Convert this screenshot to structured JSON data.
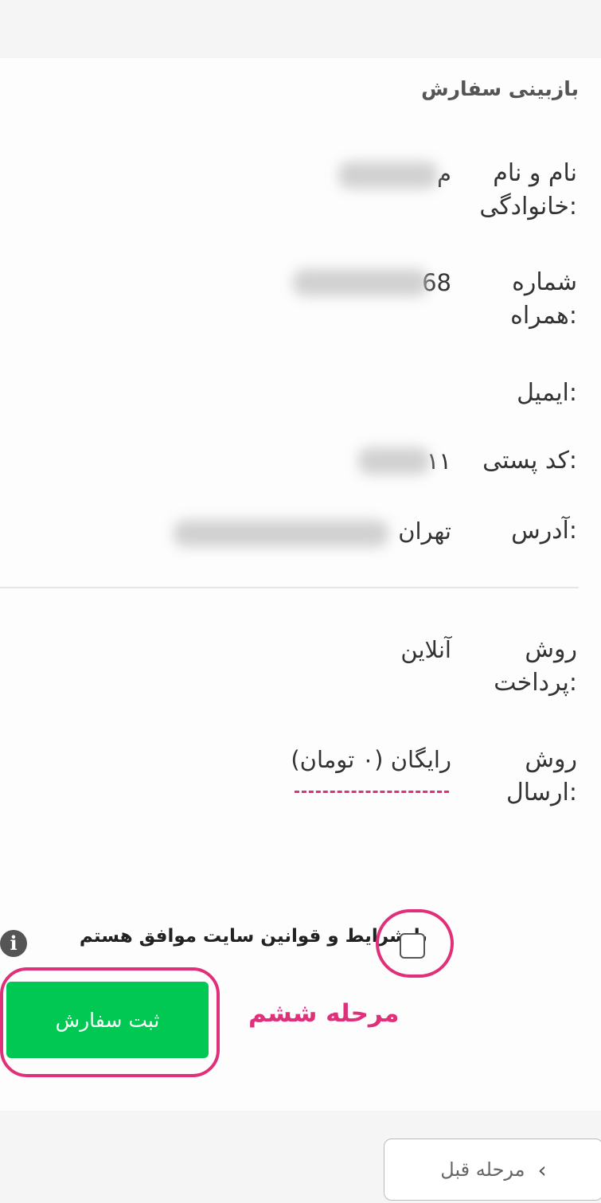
{
  "review": {
    "title": "بازبینی سفارش",
    "name": {
      "label": "نام و نام خانوادگی:",
      "value_visible": "م"
    },
    "phone": {
      "label": "شماره همراه:",
      "value_visible": "68"
    },
    "email": {
      "label": "ایمیل:",
      "value": ""
    },
    "postal": {
      "label": "کد پستی:",
      "value_visible": "۱۱"
    },
    "address": {
      "label": "آدرس:",
      "value_visible": "تهران"
    },
    "payment": {
      "label": "روش پرداخت:",
      "value": "آنلاین"
    },
    "shipping": {
      "label": "روش ارسال:",
      "value": "رایگان (۰ تومان)"
    }
  },
  "terms": {
    "text": "با شرایط و قوانین سایت موافق هستم",
    "checked": false,
    "info_icon": "info-icon"
  },
  "submit": {
    "label": "ثبت سفارش"
  },
  "annotation": {
    "step_label": "مرحله ششم",
    "color": "#e0307a"
  },
  "footer": {
    "prev_label": "مرحله قبل",
    "prev_icon": "chevron-right-icon"
  },
  "colors": {
    "submit": "#00c853",
    "annotation": "#e0307a"
  }
}
